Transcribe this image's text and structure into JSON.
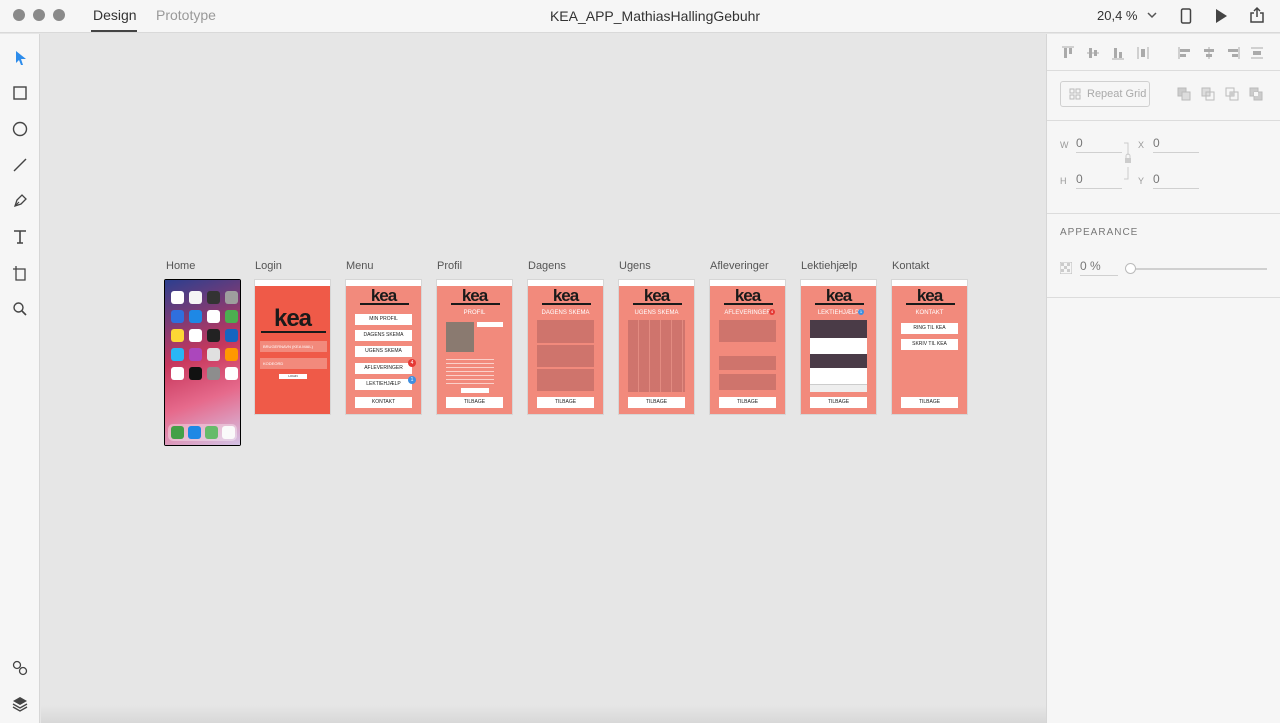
{
  "titlebar": {
    "tabs": [
      {
        "label": "Design",
        "active": true
      },
      {
        "label": "Prototype",
        "active": false
      }
    ],
    "document_title": "KEA_APP_MathiasHallingGebuhr",
    "zoom": "20,4 %"
  },
  "toolbar": {
    "tools": [
      "select-tool",
      "rectangle-tool",
      "ellipse-tool",
      "line-tool",
      "pen-tool",
      "text-tool",
      "artboard-tool",
      "zoom-tool"
    ],
    "bottom_tools": [
      "symbols-panel",
      "layers-panel"
    ]
  },
  "artboards": [
    {
      "label": "Home",
      "type": "iphone"
    },
    {
      "label": "Login",
      "type": "login",
      "logo": "kea",
      "fields": [
        "BRUGERNAVN (KEA MAIL)",
        "KODEORD"
      ],
      "button": "LOGIN"
    },
    {
      "label": "Menu",
      "type": "menu",
      "logo": "kea",
      "buttons": [
        "MIN PROFIL",
        "DAGENS SKEMA",
        "UGENS SKEMA",
        "AFLEVERINGER",
        "LEKTIEHJÆLP",
        "KONTAKT"
      ],
      "badges": {
        "afleveringer": "4",
        "lektiehjaelp": "1"
      }
    },
    {
      "label": "Profil",
      "type": "profile",
      "logo": "kea",
      "heading": "PROFIL",
      "button": "TILBAGE"
    },
    {
      "label": "Dagens",
      "type": "panels",
      "logo": "kea",
      "heading": "DAGENS SKEMA",
      "button": "TILBAGE"
    },
    {
      "label": "Ugens",
      "type": "grid",
      "logo": "kea",
      "heading": "UGENS SKEMA",
      "button": "TILBAGE"
    },
    {
      "label": "Afleveringer",
      "type": "list",
      "logo": "kea",
      "heading": "AFLEVERINGER",
      "button": "TILBAGE",
      "badge": "4"
    },
    {
      "label": "Lektiehjælp",
      "type": "chat",
      "logo": "kea",
      "heading": "LEKTIEHJÆLP",
      "button": "TILBAGE",
      "badge": "1"
    },
    {
      "label": "Kontakt",
      "type": "contact",
      "logo": "kea",
      "heading": "KONTAKT",
      "buttons": [
        "RING TIL KEA",
        "SKRIV TIL KEA"
      ],
      "button": "TILBAGE"
    }
  ],
  "right_panel": {
    "repeat_grid": "Repeat Grid",
    "w_label": "W",
    "w_value": "0",
    "h_label": "H",
    "h_value": "0",
    "x_label": "X",
    "x_value": "0",
    "y_label": "Y",
    "y_value": "0",
    "appearance_title": "APPEARANCE",
    "opacity": "0 %",
    "opacity_level": 0
  },
  "colors": {
    "artboard": "#f28a7c",
    "login": "#ef5a48",
    "badge_red": "#e53935",
    "badge_blue": "#3f8fe0"
  }
}
